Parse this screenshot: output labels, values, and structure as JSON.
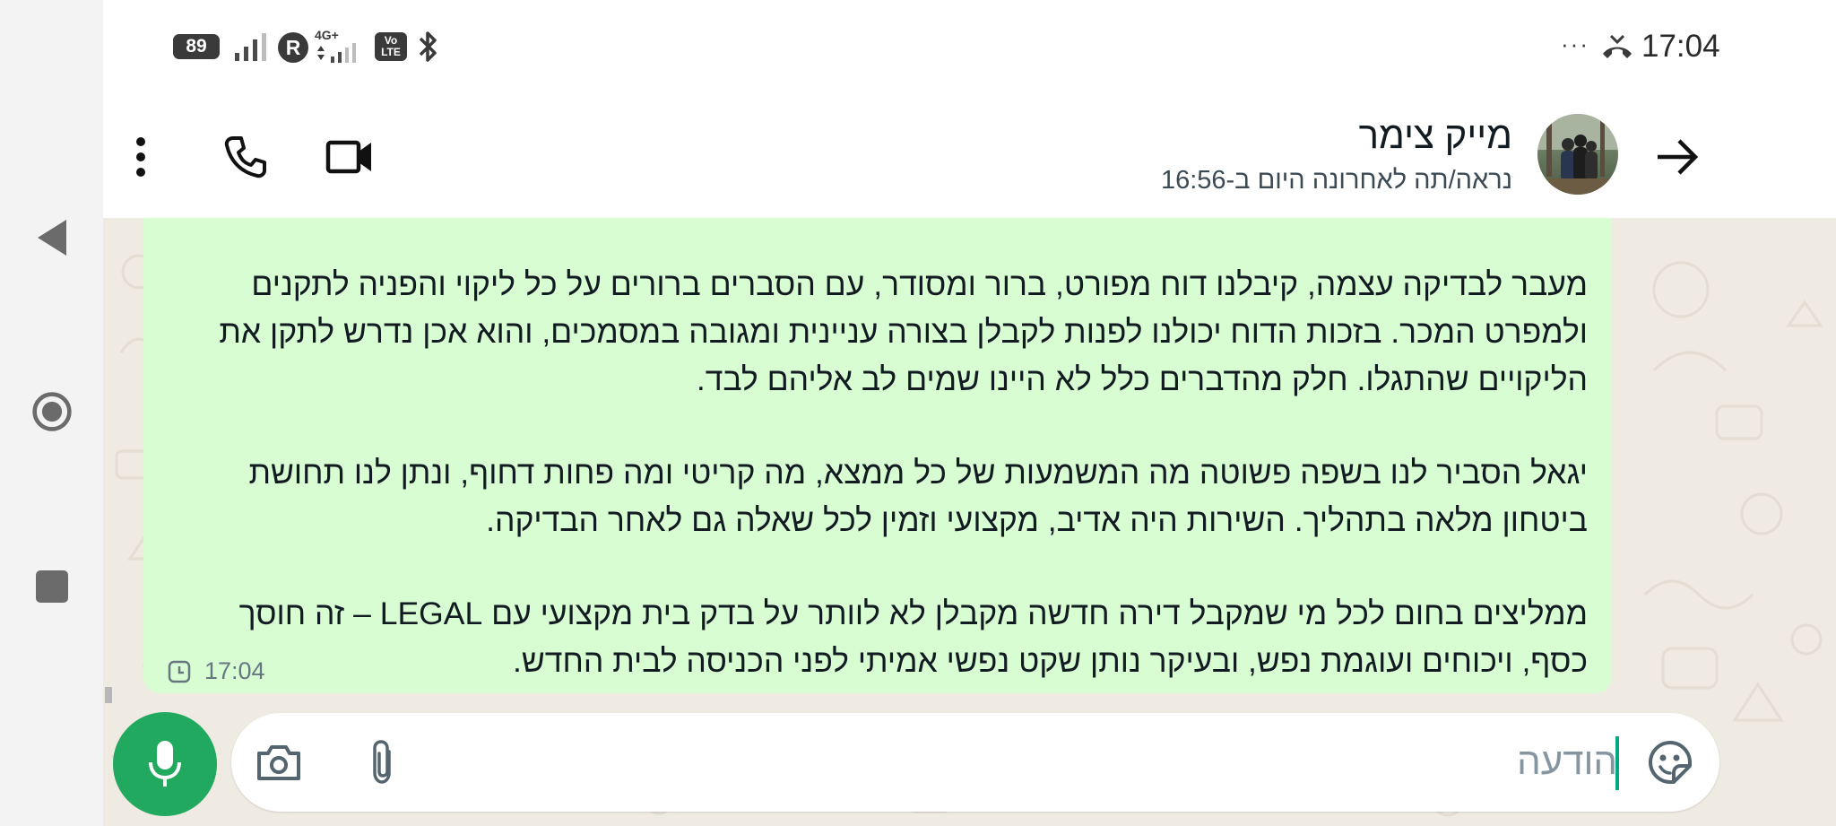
{
  "status_bar": {
    "battery": "89",
    "network_type": "4G+",
    "roaming": "R",
    "volte": "Vo LTE",
    "more": "···",
    "time": "17:04"
  },
  "header": {
    "contact_name": "מייק צימר",
    "last_seen": "נראה/תה לאחרונה היום ב-16:56"
  },
  "message": {
    "paragraphs": [
      "מעבר לבדיקה עצמה, קיבלנו דוח מפורט, ברור ומסודר, עם הסברים ברורים על כל ליקוי והפניה לתקנים ולמפרט המכר. בזכות הדוח יכולנו לפנות לקבלן בצורה עניינית ומגובה במסמכים, והוא אכן נדרש לתקן את הליקויים שהתגלו. חלק מהדברים כלל לא היינו שמים לב אליהם לבד.",
      "יגאל הסביר לנו בשפה פשוטה מה המשמעות של כל ממצא, מה קריטי ומה פחות דחוף, ונתן לנו תחושת ביטחון מלאה בתהליך. השירות היה אדיב, מקצועי וזמין לכל שאלה גם לאחר הבדיקה.",
      "ממליצים בחום לכל מי שמקבל דירה חדשה מקבלן לא לוותר על בדק בית מקצועי עם LEGAL – זה חוסך כסף, ויכוחים ועוגמת נפש, ובעיקר נותן שקט נפשי אמיתי לפני הכניסה לבית החדש."
    ],
    "time": "17:04"
  },
  "composer": {
    "placeholder": "הודעה"
  },
  "colors": {
    "accent_green": "#21a95f",
    "bubble_green": "#d9fdd3",
    "chat_background": "#efeae2"
  }
}
